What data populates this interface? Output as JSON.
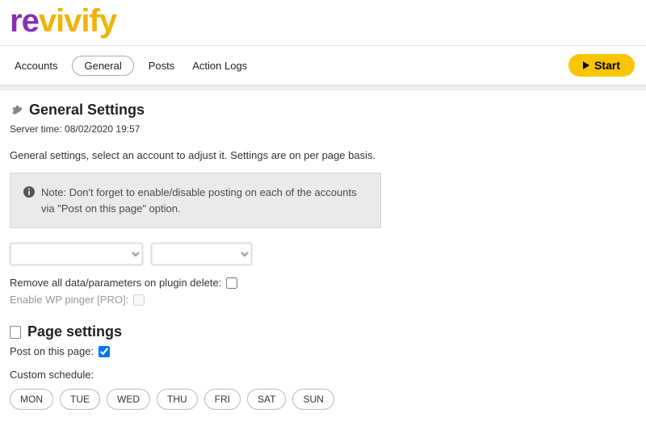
{
  "logo": {
    "part1": "re",
    "part2": "vivify"
  },
  "nav": {
    "tabs": [
      "Accounts",
      "General",
      "Posts",
      "Action Logs"
    ],
    "active": "General",
    "start": "Start"
  },
  "general": {
    "title": "General Settings",
    "server_time_label": "Server time: ",
    "server_time": "08/02/2020 19:57",
    "description": "General settings, select an account to adjust it. Settings are on per page basis.",
    "note": "Note: Don't forget to enable/disable posting on each of the accounts via \"Post on this page\" option.",
    "select_account_placeholder": "",
    "select_page_placeholder": "",
    "remove_data_label": "Remove all data/parameters on plugin delete:",
    "remove_data_checked": false,
    "wp_pinger_label": "Enable WP pinger [PRO]:",
    "wp_pinger_checked": false
  },
  "page_settings": {
    "title": "Page settings",
    "post_label": "Post on this page:",
    "post_checked": true,
    "schedule_label": "Custom schedule:",
    "days": [
      "MON",
      "TUE",
      "WED",
      "THU",
      "FRI",
      "SAT",
      "SUN"
    ]
  }
}
